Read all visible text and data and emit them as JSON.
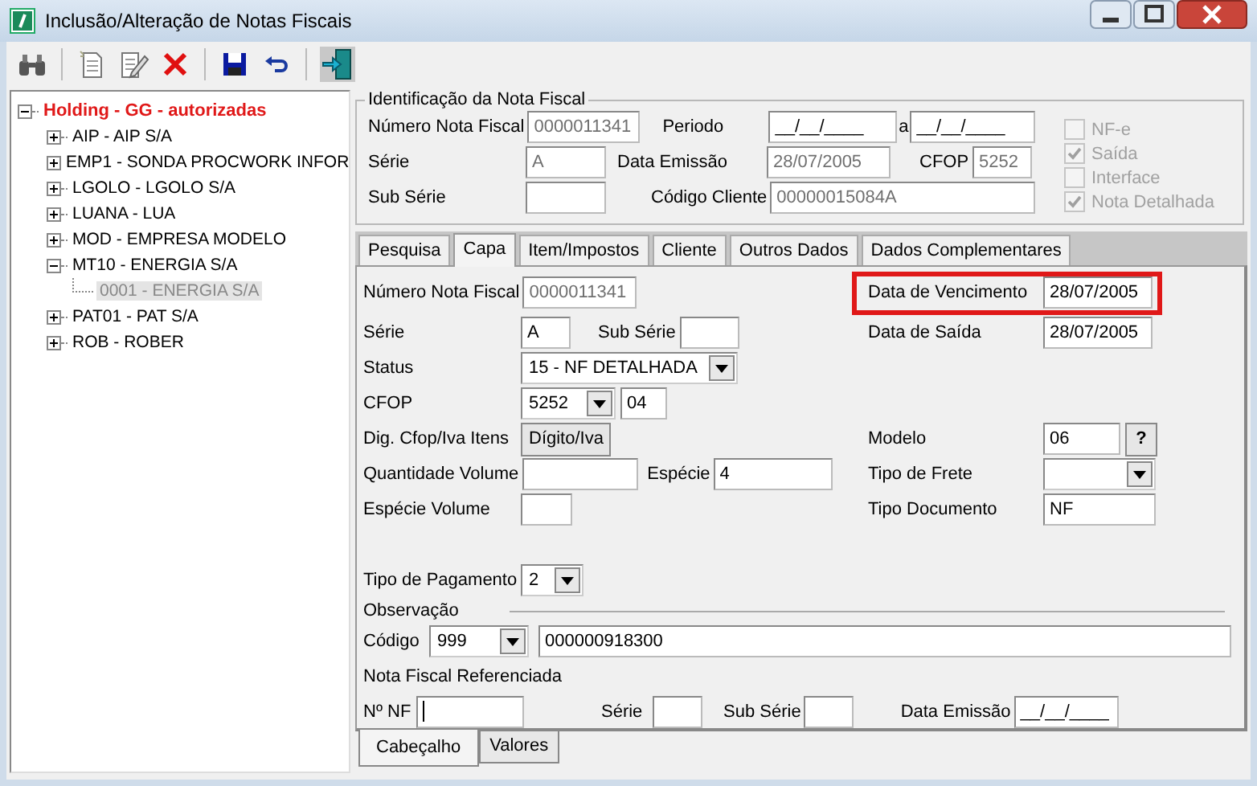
{
  "window": {
    "title": "Inclusão/Alteração de Notas Fiscais"
  },
  "tree": {
    "label": "Holding -  GG -  autorizadas",
    "expanded": true,
    "selected": false,
    "children": [
      {
        "label": "AIP - AIP S/A",
        "expanded": false,
        "selected": false
      },
      {
        "label": "EMP1 - SONDA PROCWORK INFOR",
        "expanded": false,
        "selected": false
      },
      {
        "label": "LGOLO - LGOLO S/A",
        "expanded": false,
        "selected": false
      },
      {
        "label": "LUANA - LUA",
        "expanded": false,
        "selected": false
      },
      {
        "label": "MOD - EMPRESA MODELO",
        "expanded": false,
        "selected": false
      },
      {
        "label": "MT10 - ENERGIA S/A",
        "expanded": true,
        "selected": false,
        "children": [
          {
            "label": "0001 - ENERGIA S/A",
            "selected": true
          }
        ]
      },
      {
        "label": "PAT01 - PAT S/A",
        "expanded": false,
        "selected": false
      },
      {
        "label": "ROB - ROBER",
        "expanded": false,
        "selected": false
      }
    ]
  },
  "identificacao": {
    "title": "Identificação da Nota Fiscal",
    "numero": {
      "label": "Número Nota Fiscal",
      "value": "0000011341",
      "disabled": true
    },
    "periodo": {
      "label": "Periodo",
      "from": "__/__/____",
      "separator": "a",
      "to": "__/__/____"
    },
    "serie": {
      "label": "Série",
      "value": "A",
      "disabled": true
    },
    "data_emissao": {
      "label": "Data Emissão",
      "value": "28/07/2005",
      "disabled": true
    },
    "cfop": {
      "label": "CFOP",
      "value": "5252",
      "disabled": true
    },
    "sub_serie": {
      "label": "Sub Série"
    },
    "codigo_cliente": {
      "label": "Código Cliente",
      "value": "00000015084A",
      "disabled": true
    },
    "checkboxes": [
      {
        "label": "NF-e",
        "checked": false,
        "disabled": true
      },
      {
        "label": "Saída",
        "checked": true,
        "disabled": true
      },
      {
        "label": "Interface",
        "checked": false,
        "disabled": true
      },
      {
        "label": "Nota Detalhada",
        "checked": true,
        "disabled": true
      }
    ]
  },
  "tabs": [
    {
      "label": "Pesquisa",
      "selected": false
    },
    {
      "label": "Capa",
      "selected": true
    },
    {
      "label": "Item/Impostos",
      "selected": false
    },
    {
      "label": "Cliente",
      "selected": false
    },
    {
      "label": "Outros Dados",
      "selected": false
    },
    {
      "label": "Dados Complementares",
      "selected": false
    }
  ],
  "capa": {
    "numero": {
      "label": "Número Nota Fiscal",
      "value": "0000011341",
      "disabled": true
    },
    "serie": {
      "label": "Série",
      "value": "A"
    },
    "sub_serie": {
      "label": "Sub Série"
    },
    "status": {
      "label": "Status",
      "value": "15 - NF DETALHADA"
    },
    "cfop": {
      "label": "CFOP",
      "value": "5252",
      "digit": "04"
    },
    "dig_cfop": {
      "label": "Dig. Cfop/Iva Itens",
      "button": "Dígito/Iva"
    },
    "quantidade_volume": {
      "label": "Quantidade Volume"
    },
    "especie": {
      "label": "Espécie",
      "value": "4"
    },
    "especie_volume": {
      "label": "Espécie Volume"
    },
    "data_vencimento": {
      "label": "Data de Vencimento",
      "value": "28/07/2005",
      "highlighted": true
    },
    "data_saida": {
      "label": "Data de Saída",
      "value": "28/07/2005"
    },
    "modelo": {
      "label": "Modelo",
      "value": "06",
      "button": "?"
    },
    "tipo_frete": {
      "label": "Tipo de Frete"
    },
    "tipo_documento": {
      "label": "Tipo Documento",
      "value": "NF"
    },
    "tipo_pagamento": {
      "label": "Tipo de Pagamento",
      "value": "2"
    },
    "observacao": {
      "title": "Observação",
      "codigo_label": "Código",
      "codigo": "999",
      "text": "000000918300"
    },
    "nf_referenciada": {
      "title": "Nota Fiscal Referenciada",
      "numero_label": "Nº NF",
      "serie_label": "Série",
      "sub_serie_label": "Sub Série",
      "data_emissao_label": "Data Emissão",
      "data_emissao": "__/__/____"
    }
  },
  "bottom_tabs": [
    {
      "label": "Cabeçalho",
      "selected": true
    },
    {
      "label": "Valores",
      "selected": false
    }
  ]
}
